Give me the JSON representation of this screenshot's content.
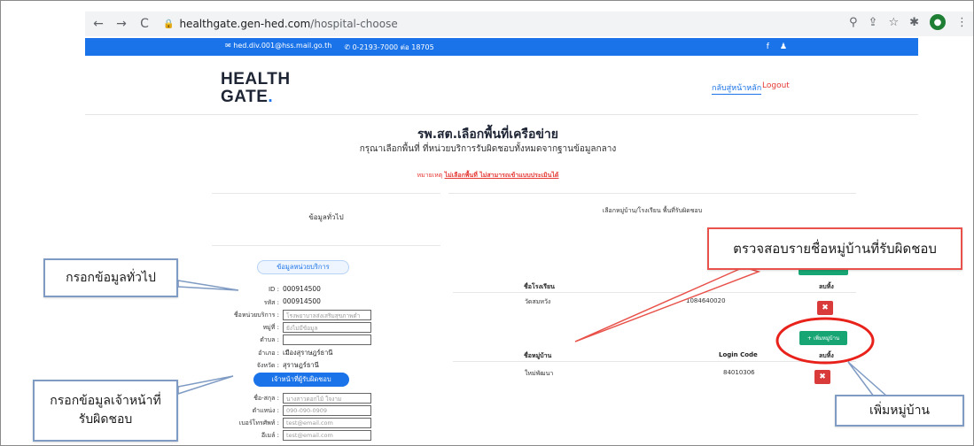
{
  "browser": {
    "url_domain": "healthgate.gen-hed.com",
    "url_path": "/hospital-choose",
    "back": "←",
    "forward": "→",
    "reload": "C"
  },
  "topbar": {
    "email": "hed.div.001@hss.mail.go.th",
    "phone": "0-2193-7000 ต่อ 18705",
    "social_f": "f",
    "social_2": "♟"
  },
  "header": {
    "logo_line1": "HEALTH",
    "logo_line2": "GATE",
    "logo_dot": ".",
    "nav_home": "กลับสู่หน้าหลัก",
    "nav_logout": "Logout"
  },
  "page": {
    "title": "รพ.สต.เลือกพื้นที่เครือข่าย",
    "subtitle": "กรุณาเลือกพื้นที่ ที่หน่วยบริการรับผิดชอบทั้งหมดจากฐานข้อมูลกลาง",
    "note_prefix": "หมายเหตุ",
    "note_link": "ไม่เลือกพื้นที่ ไม่สามารถเข้าแบบประเมินได้"
  },
  "left_panel": {
    "heading": "ข้อมูลทั่วไป",
    "unit_section": "ข้อมูลหน่วยบริการ",
    "fields": [
      {
        "label": "ID :",
        "value": "000914500"
      },
      {
        "label": "รหัส :",
        "value": "000914500"
      },
      {
        "label": "ชื่อหน่วยบริการ :",
        "value": "โรงพยาบาลส่งเสริมสุขภาพตำ"
      },
      {
        "label": "หมู่ที่ :",
        "value": "ยังไม่มีข้อมูล"
      },
      {
        "label": "ตำบล :",
        "value": ""
      },
      {
        "label": "อำเภอ :",
        "value": "เมืองสุราษฎร์ธานี"
      },
      {
        "label": "จังหวัด :",
        "value": "สุราษฎร์ธานี"
      }
    ],
    "staff_section": "เจ้าหน้าที่ผู้รับผิดชอบ",
    "staff_fields": [
      {
        "label": "ชื่อ-สกุล :",
        "value": "นางสาวดอกไม้ ใจงาม"
      },
      {
        "label": "ตำแหน่ง :",
        "value": "090-090-0909"
      },
      {
        "label": "เบอร์โทรศัพท์ :",
        "value": "test@email.com"
      },
      {
        "label": "อีเมล์ :",
        "value": "test@email.com"
      }
    ]
  },
  "right_panel": {
    "heading": "เลือกหมู่บ้าน/โรงเรียน พื้นที่รับผิดชอบ",
    "school_table": {
      "col_name": "ชื่อโรงเรียน",
      "col_delete": "ลบทิ้ง",
      "rows": [
        {
          "name": "วัดสมหวัง",
          "code": "1084640020"
        }
      ]
    },
    "add_village_button": "เพิ่มหมู่บ้าน",
    "add_village_plus": "+",
    "village_table": {
      "col_name": "ชื่อหมู่บ้าน",
      "col_code": "Login Code",
      "col_delete": "ลบทิ้ง",
      "rows": [
        {
          "name": "ใหม่พัฒนา",
          "code": "84010306"
        }
      ]
    },
    "delete_icon": "✖"
  },
  "annotations": {
    "general_info": "กรอกข้อมูลทั่วไป",
    "staff_info_line1": "กรอกข้อมูลเจ้าหน้าที่",
    "staff_info_line2": "รับผิดชอบ",
    "check_villages": "ตรวจสอบรายชื่อหมู่บ้านที่รับผิดชอบ",
    "add_village": "เพิ่มหมู่บ้าน"
  },
  "colors": {
    "brand_blue": "#1a73e8",
    "danger_red": "#d93a3a",
    "teal": "#18a574",
    "callout_border": "#7f9bc4",
    "annotation_red": "#e8524a"
  }
}
